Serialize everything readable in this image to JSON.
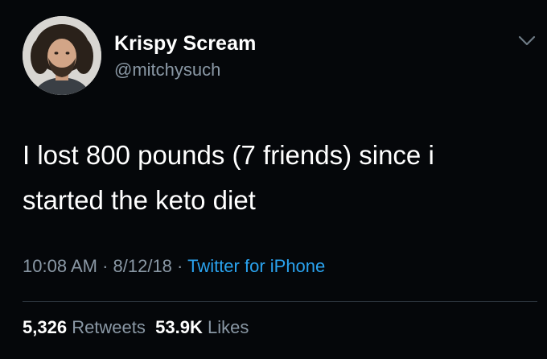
{
  "author": {
    "display_name": "Krispy Scream",
    "handle": "@mitchysuch"
  },
  "tweet": {
    "text_line1": "I lost 800 pounds (7 friends) since i",
    "text_line2": "started the keto diet"
  },
  "meta": {
    "time": "10:08 AM",
    "sep1": " · ",
    "date": "8/12/18",
    "sep2": " · ",
    "source": "Twitter for iPhone"
  },
  "stats": {
    "retweets_count": "5,326",
    "retweets_label": "Retweets",
    "likes_count": "53.9K",
    "likes_label": "Likes"
  },
  "icons": {
    "menu": "chevron-down-icon"
  },
  "colors": {
    "background": "#05070a",
    "secondary_text": "#8a98a5",
    "link": "#2aa3ef"
  }
}
